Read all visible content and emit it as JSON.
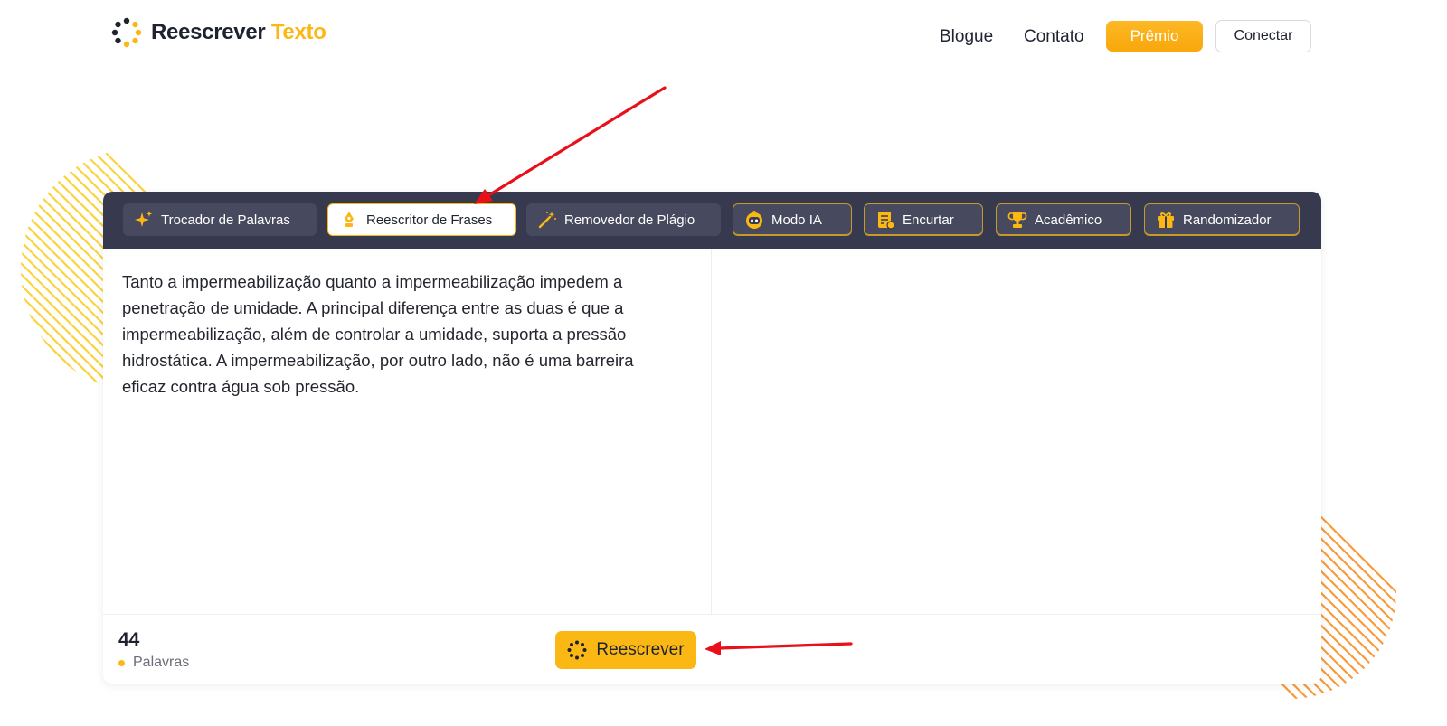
{
  "brand": {
    "name_part1": "Reescrever",
    "name_part2": "Texto",
    "accent_color": "#fbb714"
  },
  "nav": {
    "blog": "Blogue",
    "contact": "Contato",
    "premium": "Prêmio",
    "connect": "Conectar"
  },
  "modes": [
    {
      "label": "Trocador de Palavras",
      "icon": "sparkle-icon",
      "active": false,
      "premium": false
    },
    {
      "label": "Reescritor de Frases",
      "icon": "pen-nib-icon",
      "active": true,
      "premium": false
    },
    {
      "label": "Removedor de Plágio",
      "icon": "magic-wand-icon",
      "active": false,
      "premium": false
    },
    {
      "label": "Modo IA",
      "icon": "robot-icon",
      "active": false,
      "premium": true
    },
    {
      "label": "Encurtar",
      "icon": "document-icon",
      "active": false,
      "premium": true
    },
    {
      "label": "Acadêmico",
      "icon": "trophy-icon",
      "active": false,
      "premium": true
    },
    {
      "label": "Randomizador",
      "icon": "gift-icon",
      "active": false,
      "premium": true
    }
  ],
  "editor": {
    "input_text": "Tanto a impermeabilização quanto a impermeabilização impedem a penetração de umidade. A principal diferença entre as duas é que a impermeabilização, além de controlar a umidade, suporta a pressão hidrostática. A impermeabilização, por outro lado, não é uma barreira eficaz contra água sob pressão.",
    "output_text": ""
  },
  "footer": {
    "word_count": "44",
    "word_label": "Palavras",
    "rewrite_button": "Reescrever"
  }
}
